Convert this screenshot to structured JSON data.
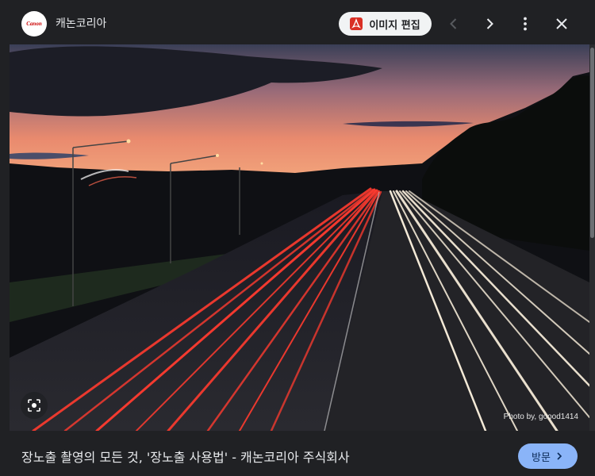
{
  "header": {
    "logo_text": "Canon",
    "site_name": "캐논코리아",
    "edit_label": "이미지 편집"
  },
  "image": {
    "credit": "Photo by, goood1414"
  },
  "footer": {
    "caption": "장노출 촬영의 모든 것, '장노출 사용법' - 캐논코리아 주식회사",
    "visit_label": "방문"
  },
  "icons": {
    "edit": "pdf-icon",
    "prev": "chevron-left-icon",
    "next": "chevron-right-icon",
    "more": "more-vert-icon",
    "close": "close-icon",
    "lens": "lens-icon",
    "visit": "chevron-right-icon"
  },
  "colors": {
    "background": "#202124",
    "visit_button": "#8ab4f8",
    "pdf_icon": "#d93025"
  }
}
